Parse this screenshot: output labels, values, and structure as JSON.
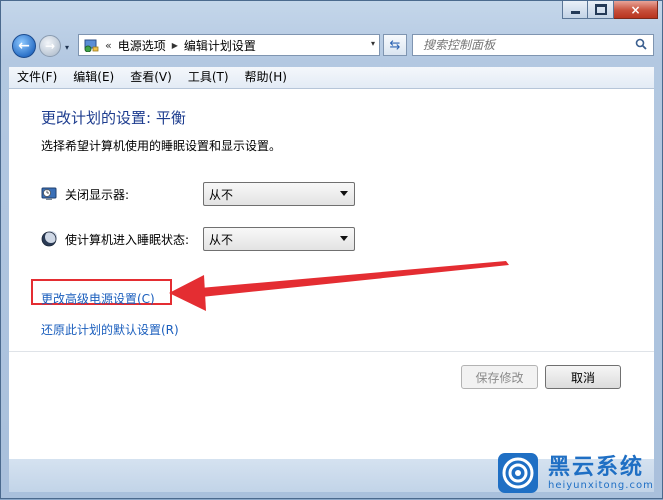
{
  "window": {
    "caption": {
      "minimize": "minimize",
      "maximize": "maximize",
      "close": "×"
    }
  },
  "nav": {
    "back_icon": "back-arrow-icon",
    "forward_icon": "forward-arrow-icon",
    "history_drop": "▾"
  },
  "address": {
    "chevrons": "«",
    "crumbs": [
      "电源选项",
      "编辑计划设置"
    ],
    "separator": "▶",
    "drop": "▾"
  },
  "search": {
    "placeholder": "搜索控制面板"
  },
  "menu": {
    "items": [
      "文件(F)",
      "编辑(E)",
      "查看(V)",
      "工具(T)",
      "帮助(H)"
    ]
  },
  "page": {
    "title": "更改计划的设置: 平衡",
    "subtitle": "选择希望计算机使用的睡眠设置和显示设置。",
    "display_off": {
      "label": "关闭显示器:",
      "value": "从不"
    },
    "sleep": {
      "label": "使计算机进入睡眠状态:",
      "value": "从不"
    },
    "advanced_link": "更改高级电源设置(C)",
    "restore_link": "还原此计划的默认设置(R)",
    "save_button": "保存修改",
    "cancel_button": "取消"
  },
  "annotation": {
    "highlight_color": "#e42d32"
  },
  "watermark": {
    "title": "黑云系统",
    "url": "heiyunxitong.com"
  },
  "colors": {
    "link": "#1a5ebd",
    "title": "#1e3d8f"
  }
}
